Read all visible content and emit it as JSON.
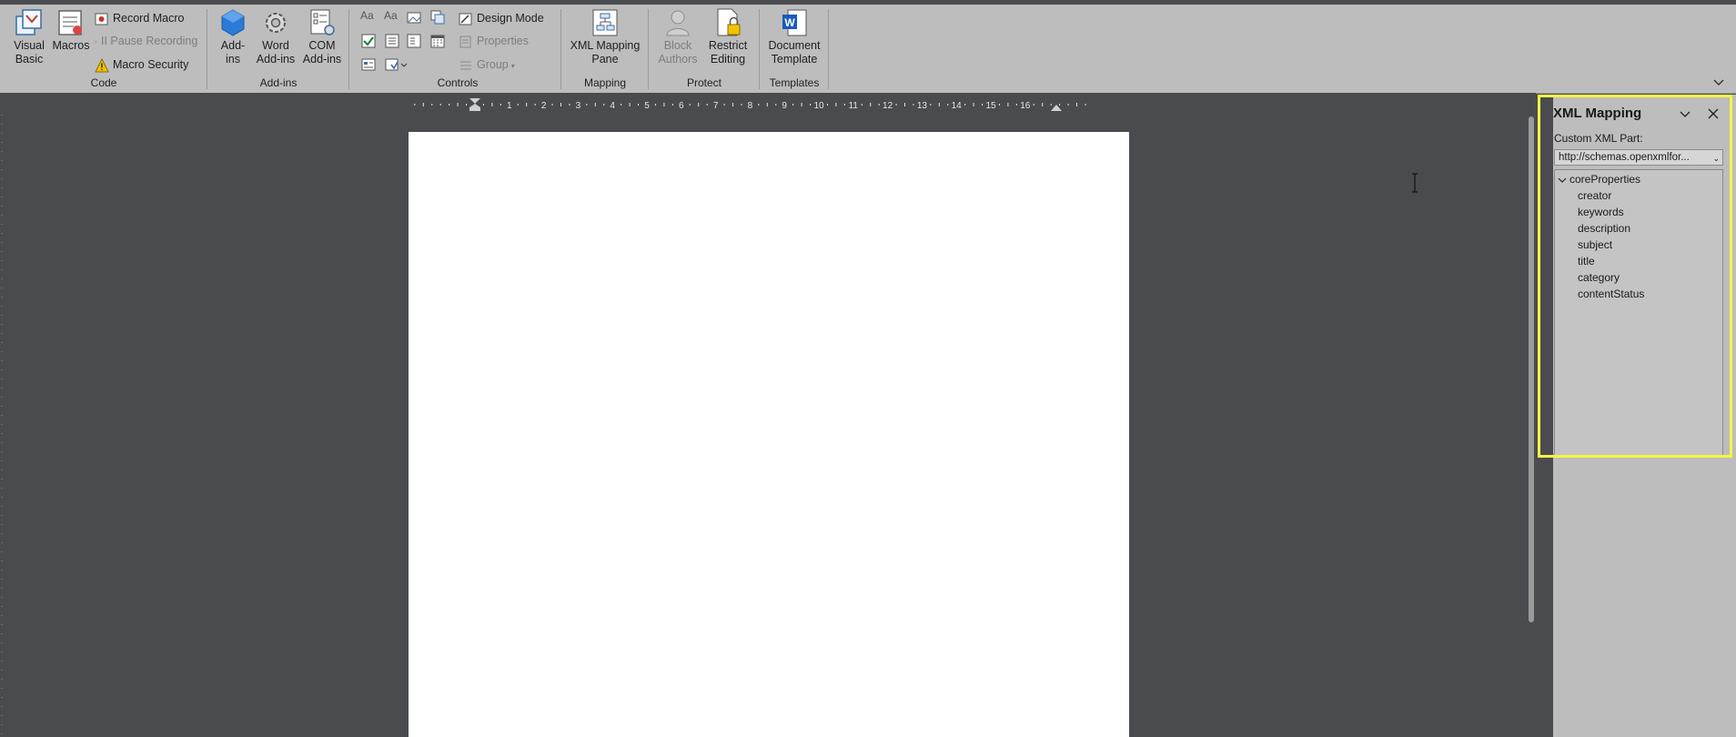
{
  "ribbon": {
    "code": {
      "label": "Code",
      "visual_basic": "Visual\nBasic",
      "macros": "Macros",
      "record_macro": "Record Macro",
      "pause_recording": "II Pause Recording",
      "macro_security": "Macro Security"
    },
    "addins": {
      "label": "Add-ins",
      "addins": "Add-\nins",
      "word_addins": "Word\nAdd-ins",
      "com_addins": "COM\nAdd-ins"
    },
    "controls": {
      "label": "Controls",
      "design_mode": "Design Mode",
      "properties": "Properties",
      "group": "Group"
    },
    "mapping": {
      "label": "Mapping",
      "xml_mapping_pane": "XML Mapping\nPane"
    },
    "protect": {
      "label": "Protect",
      "block_authors": "Block\nAuthors",
      "restrict_editing": "Restrict\nEditing"
    },
    "templates": {
      "label": "Templates",
      "document_template": "Document\nTemplate"
    }
  },
  "ruler": {
    "numbers": [
      "1",
      "2",
      "3",
      "4",
      "5",
      "6",
      "7",
      "8",
      "9",
      "10",
      "11",
      "12",
      "13",
      "14",
      "15",
      "16"
    ]
  },
  "xml_pane": {
    "title": "XML Mapping",
    "custom_part_label": "Custom XML Part:",
    "custom_part_value": "http://schemas.openxmlfor...",
    "tree_root": "coreProperties",
    "tree_children": [
      "creator",
      "keywords",
      "description",
      "subject",
      "title",
      "category",
      "contentStatus"
    ],
    "highlight_color": "#f5f542"
  },
  "colors": {
    "ribbon_bg": "#bdbdbd",
    "canvas_bg": "#4a4b4f",
    "page_bg": "#ffffff"
  }
}
